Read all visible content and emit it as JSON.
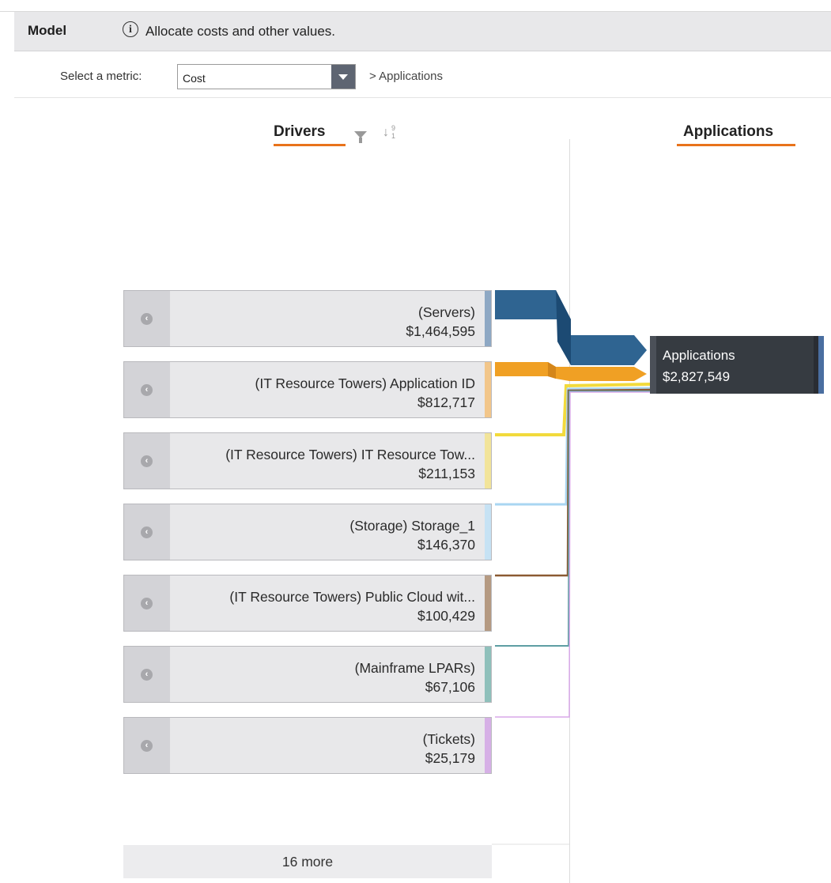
{
  "header": {
    "title": "Model",
    "info_icon": "info-icon",
    "info_text": "Allocate costs and other values."
  },
  "metric": {
    "label": "Select a metric:",
    "selected": "Cost",
    "breadcrumb": "> Applications"
  },
  "columns": {
    "left": "Drivers",
    "right": "Applications",
    "sort_digits": [
      "9",
      "1"
    ]
  },
  "drivers": [
    {
      "name": "(Servers)",
      "value": "$1,464,595",
      "color": "#2f6491"
    },
    {
      "name": "(IT Resource Towers) Application ID",
      "value": "$812,717",
      "color": "#f0a024"
    },
    {
      "name": "(IT Resource Towers) IT Resource Tow...",
      "value": "$211,153",
      "color": "#f2da3c"
    },
    {
      "name": "(Storage) Storage_1",
      "value": "$146,370",
      "color": "#a9d6f2"
    },
    {
      "name": "(IT Resource Towers) Public Cloud wit...",
      "value": "$100,429",
      "color": "#8b5a32"
    },
    {
      "name": "(Mainframe LPARs)",
      "value": "$67,106",
      "color": "#5e9ea3"
    },
    {
      "name": "(Tickets)",
      "value": "$25,179",
      "color": "#d8a8e8"
    }
  ],
  "more": "16 more",
  "target": {
    "name": "Applications",
    "value": "$2,827,549"
  },
  "colors": {
    "accent_underline": "#e8731b",
    "target_bg": "#363b41"
  }
}
